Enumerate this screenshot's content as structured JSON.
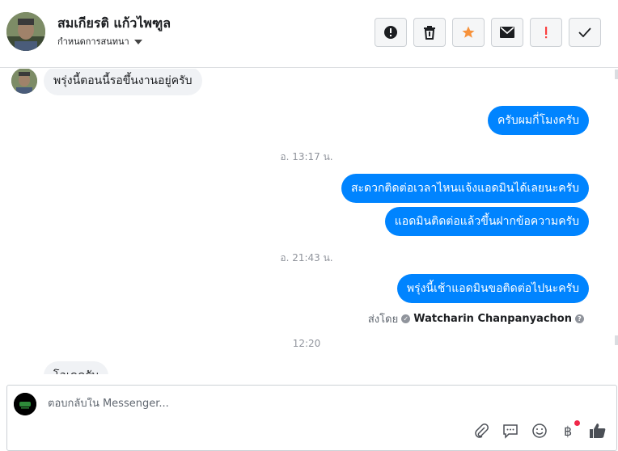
{
  "header": {
    "contact_name": "สมเกียรติ แก้วไพฑูล",
    "assign_label": "กำหนดการสนทนา",
    "actions": [
      {
        "icon": "alert-circle-icon"
      },
      {
        "icon": "trash-icon"
      },
      {
        "icon": "star-icon",
        "color": "#f7923b"
      },
      {
        "icon": "envelope-icon"
      },
      {
        "icon": "exclamation-icon",
        "color": "#fa3e3e"
      },
      {
        "icon": "checkmark-icon"
      }
    ]
  },
  "messages": {
    "m1": "พรุ่งนี้ตอนนี้รอขึ้นงานอยู่ครับ",
    "m2": "ครับผมกี่โมงครับ",
    "ts1": "อ. 13:17 น.",
    "m3": "สะดวกติดต่อเวลาไหนแจ้งแอดมินได้เลยนะครับ",
    "m4": "แอดมินติดต่อแล้วขึ้นฝากข้อความครับ",
    "ts2": "อ. 21:43 น.",
    "m5": "พรุ่งนี้เช้าแอดมินขอติดต่อไปนะครับ",
    "sent_by_prefix": "ส่งโดย",
    "sent_by_name": "Watcharin Chanpanyachon",
    "ts3": "12:20",
    "m6": "โอเคครับ"
  },
  "composer": {
    "placeholder": "ตอบกลับใน Messenger..."
  },
  "colors": {
    "outgoing_bubble": "#0084ff",
    "incoming_bubble": "#f0f2f5",
    "star": "#f7923b",
    "flag": "#fa3e3e"
  }
}
